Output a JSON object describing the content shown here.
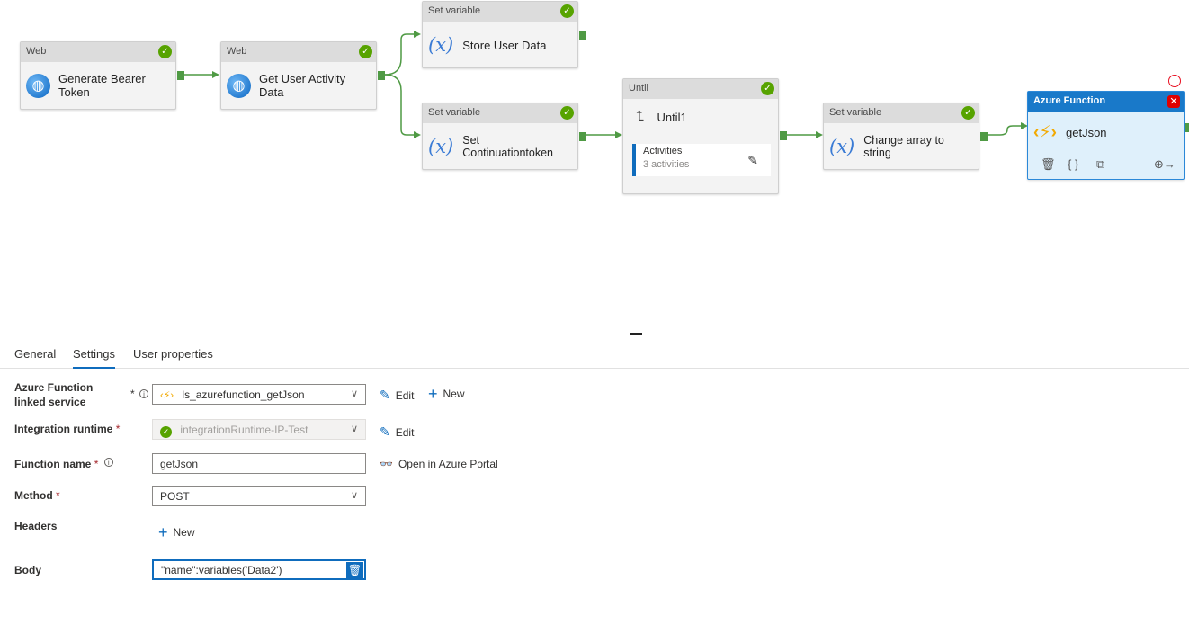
{
  "pipeline": {
    "nodes": {
      "web1": {
        "type": "Web",
        "name": "Generate Bearer Token"
      },
      "web2": {
        "type": "Web",
        "name": "Get User Activity Data"
      },
      "setvar1": {
        "type": "Set variable",
        "name": "Store User Data"
      },
      "setvar2": {
        "type": "Set variable",
        "name": "Set Continuationtoken"
      },
      "until": {
        "type": "Until",
        "name": "Until1",
        "activities_label": "Activities",
        "activities_count": "3 activities"
      },
      "setvar3": {
        "type": "Set variable",
        "name": "Change array to string"
      },
      "azfn": {
        "type": "Azure Function",
        "name": "getJson"
      }
    },
    "status_color": "#57a300",
    "error_color": "#e00000",
    "accent": "#0f6cbd"
  },
  "panel": {
    "tabs": [
      {
        "label": "General",
        "active": false
      },
      {
        "label": "Settings",
        "active": true
      },
      {
        "label": "User properties",
        "active": false
      }
    ],
    "fields": {
      "linked_service": {
        "label": "Azure Function linked service",
        "required": "*",
        "value": "ls_azurefunction_getJson",
        "edit": "Edit",
        "new": "New"
      },
      "runtime": {
        "label": "Integration runtime",
        "required": "*",
        "value": "integrationRuntime-IP-Test",
        "edit": "Edit"
      },
      "function_name": {
        "label": "Function name",
        "required": "*",
        "value": "getJson",
        "portal": "Open in Azure Portal"
      },
      "method": {
        "label": "Method",
        "required": "*",
        "value": "POST"
      },
      "headers": {
        "label": "Headers",
        "new": "New"
      },
      "body": {
        "label": "Body",
        "value": "\"name\":variables('Data2')"
      }
    }
  }
}
